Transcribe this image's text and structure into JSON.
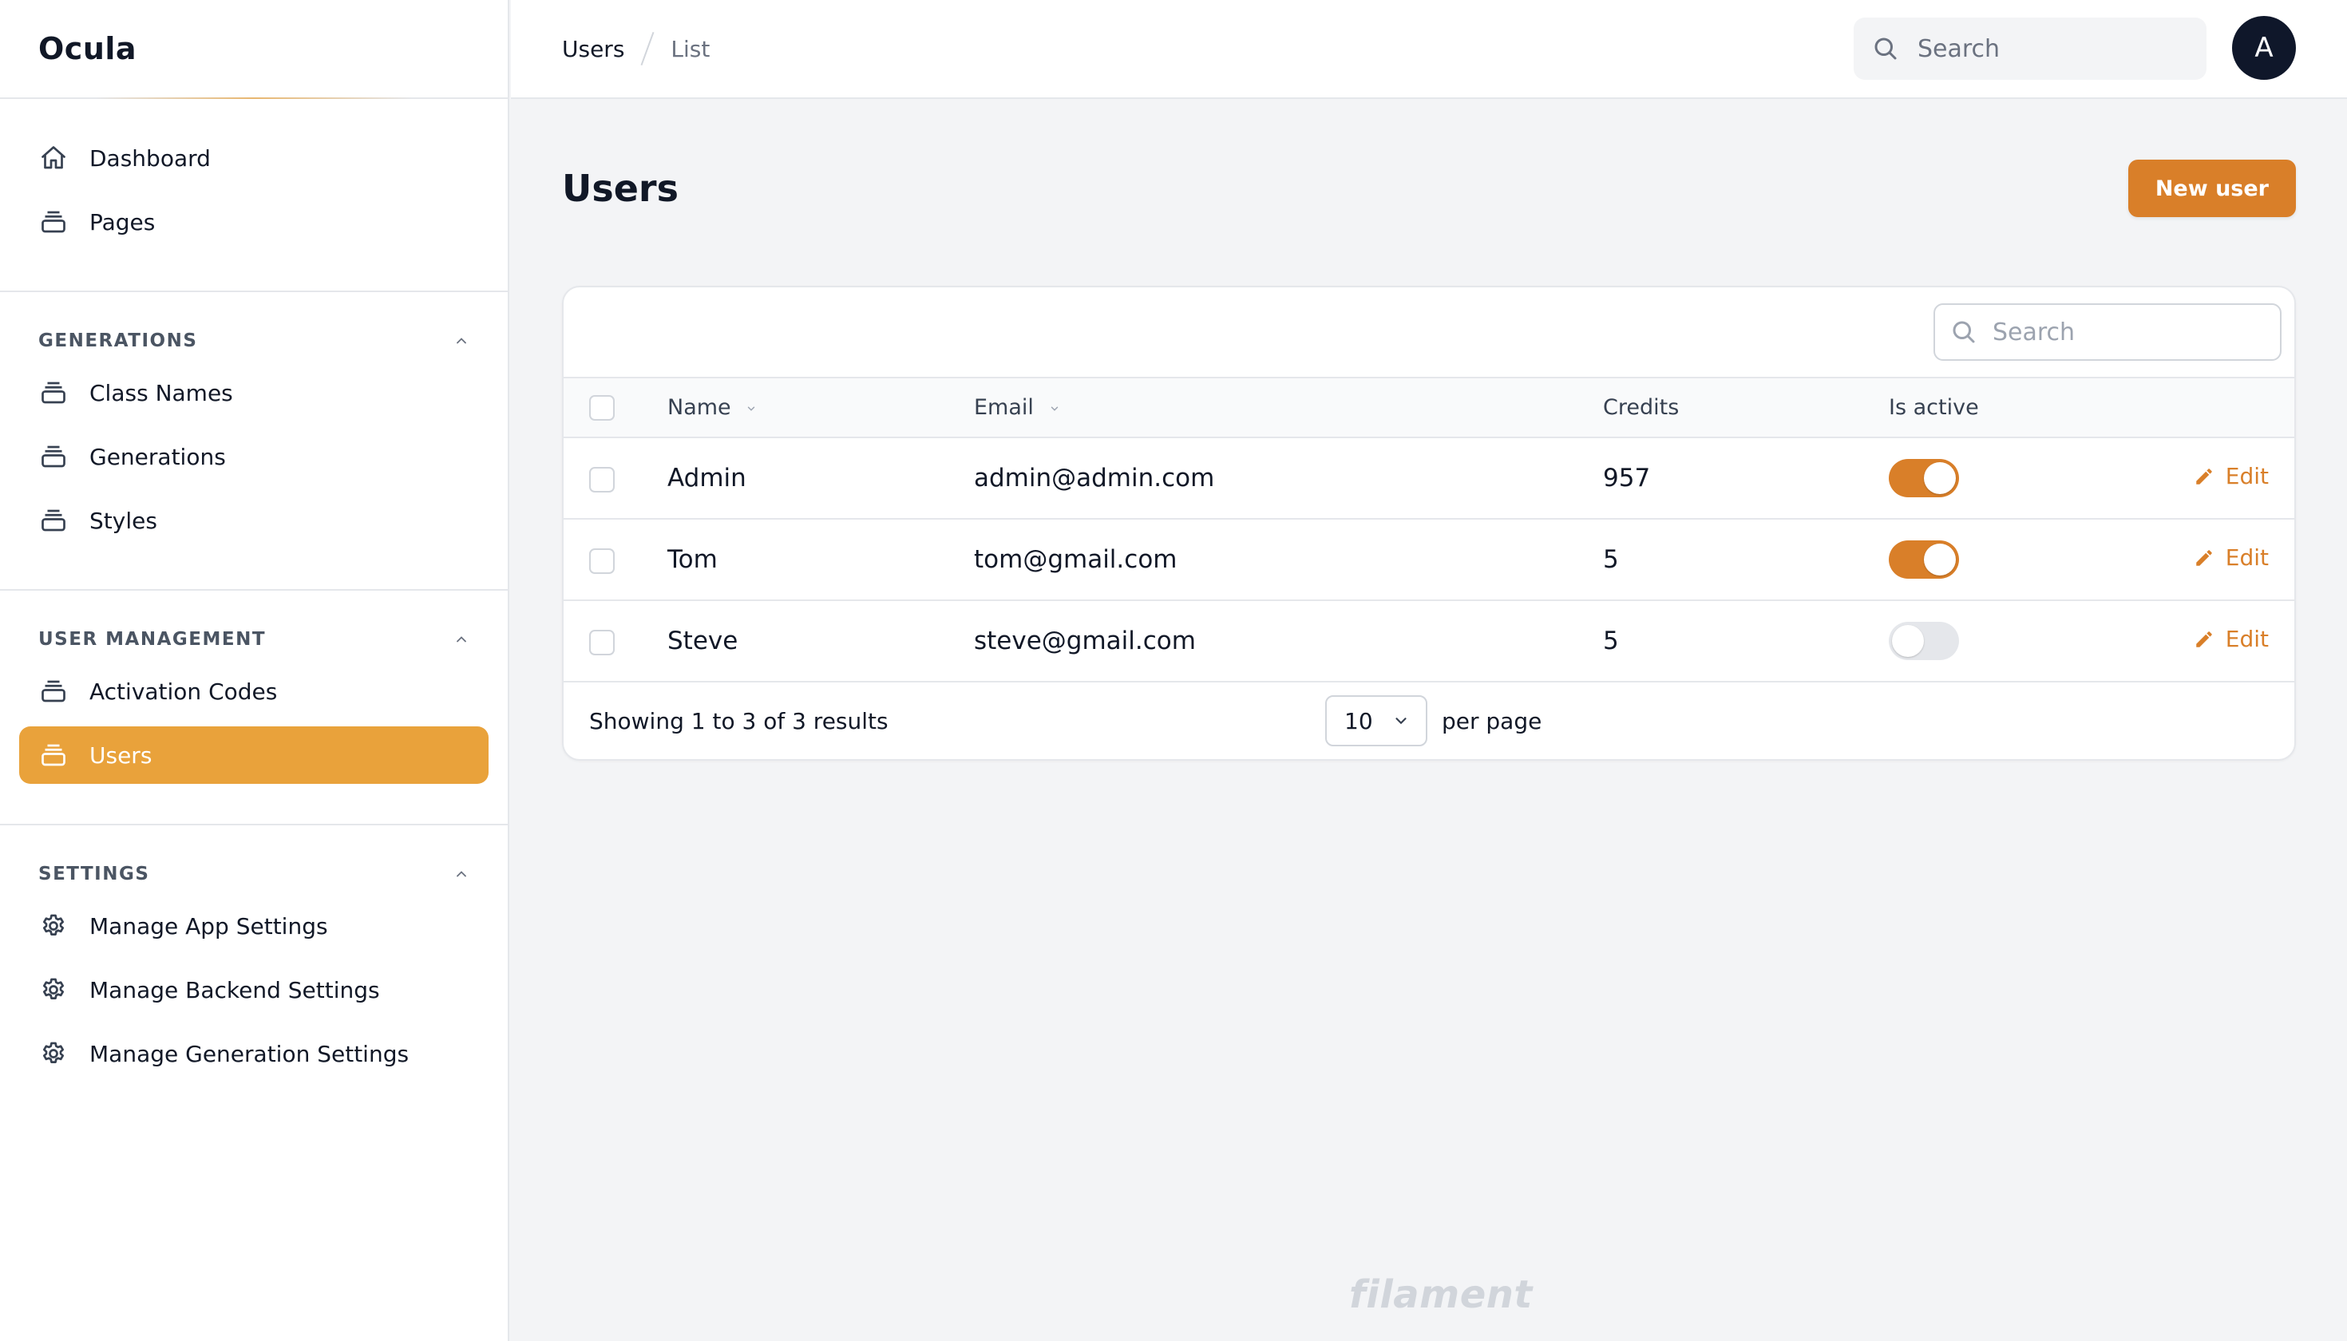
{
  "app": {
    "brand": "Ocula"
  },
  "sidebar": {
    "top_items": [
      {
        "label": "Dashboard",
        "icon": "home-icon"
      },
      {
        "label": "Pages",
        "icon": "collection-icon"
      }
    ],
    "groups": [
      {
        "title": "GENERATIONS",
        "items": [
          {
            "label": "Class Names",
            "icon": "collection-icon"
          },
          {
            "label": "Generations",
            "icon": "collection-icon"
          },
          {
            "label": "Styles",
            "icon": "collection-icon"
          }
        ]
      },
      {
        "title": "USER MANAGEMENT",
        "items": [
          {
            "label": "Activation Codes",
            "icon": "collection-icon"
          },
          {
            "label": "Users",
            "icon": "collection-icon",
            "active": true
          }
        ]
      },
      {
        "title": "SETTINGS",
        "items": [
          {
            "label": "Manage App Settings",
            "icon": "gear-icon"
          },
          {
            "label": "Manage Backend Settings",
            "icon": "gear-icon"
          },
          {
            "label": "Manage Generation Settings",
            "icon": "gear-icon"
          }
        ]
      }
    ]
  },
  "topbar": {
    "breadcrumb": [
      "Users",
      "List"
    ],
    "search_placeholder": "Search",
    "avatar_initial": "A"
  },
  "page": {
    "title": "Users",
    "new_button": "New user"
  },
  "table": {
    "search_placeholder": "Search",
    "columns": [
      "Name",
      "Email",
      "Credits",
      "Is active"
    ],
    "rows": [
      {
        "name": "Admin",
        "email": "admin@admin.com",
        "credits": "957",
        "active": true,
        "action": "Edit"
      },
      {
        "name": "Tom",
        "email": "tom@gmail.com",
        "credits": "5",
        "active": true,
        "action": "Edit"
      },
      {
        "name": "Steve",
        "email": "steve@gmail.com",
        "credits": "5",
        "active": false,
        "action": "Edit"
      }
    ],
    "footer": {
      "showing": "Showing 1 to 3 of 3 results",
      "per_page_value": "10",
      "per_page_label": "per page"
    }
  },
  "footer_brand": "filament",
  "colors": {
    "accent": "#e9a23b",
    "primary_button": "#d97f29",
    "avatar": "#0f172a"
  }
}
